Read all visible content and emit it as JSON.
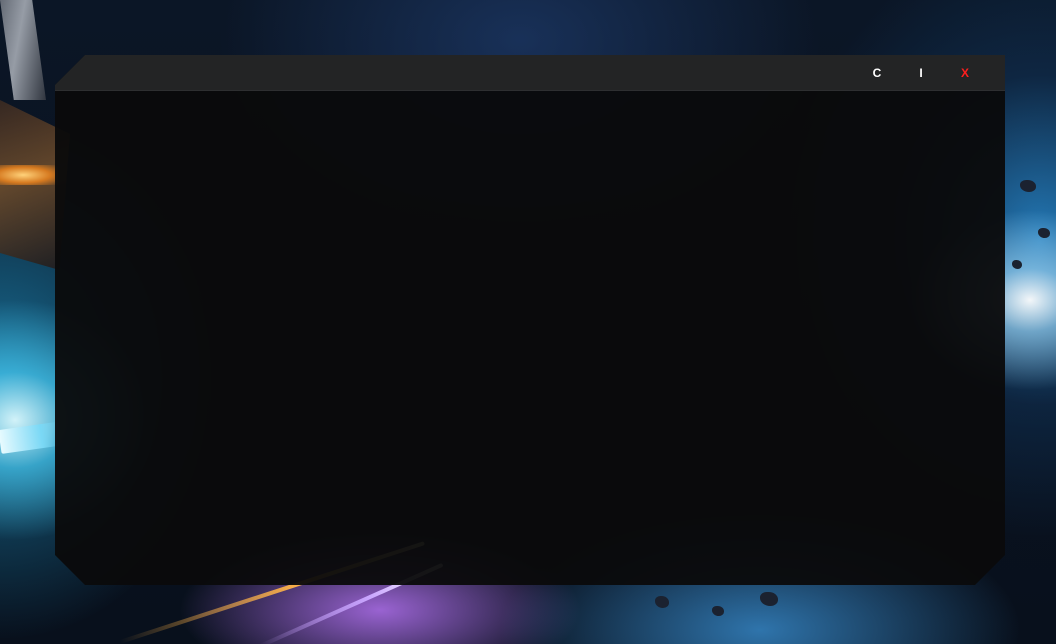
{
  "window": {
    "title_buttons": {
      "c_label": "C",
      "i_label": "I",
      "x_label": "X"
    }
  },
  "colors": {
    "close_button": "#ff1e1e",
    "title_bar": "#232425",
    "panel": "#0a0a0c"
  }
}
